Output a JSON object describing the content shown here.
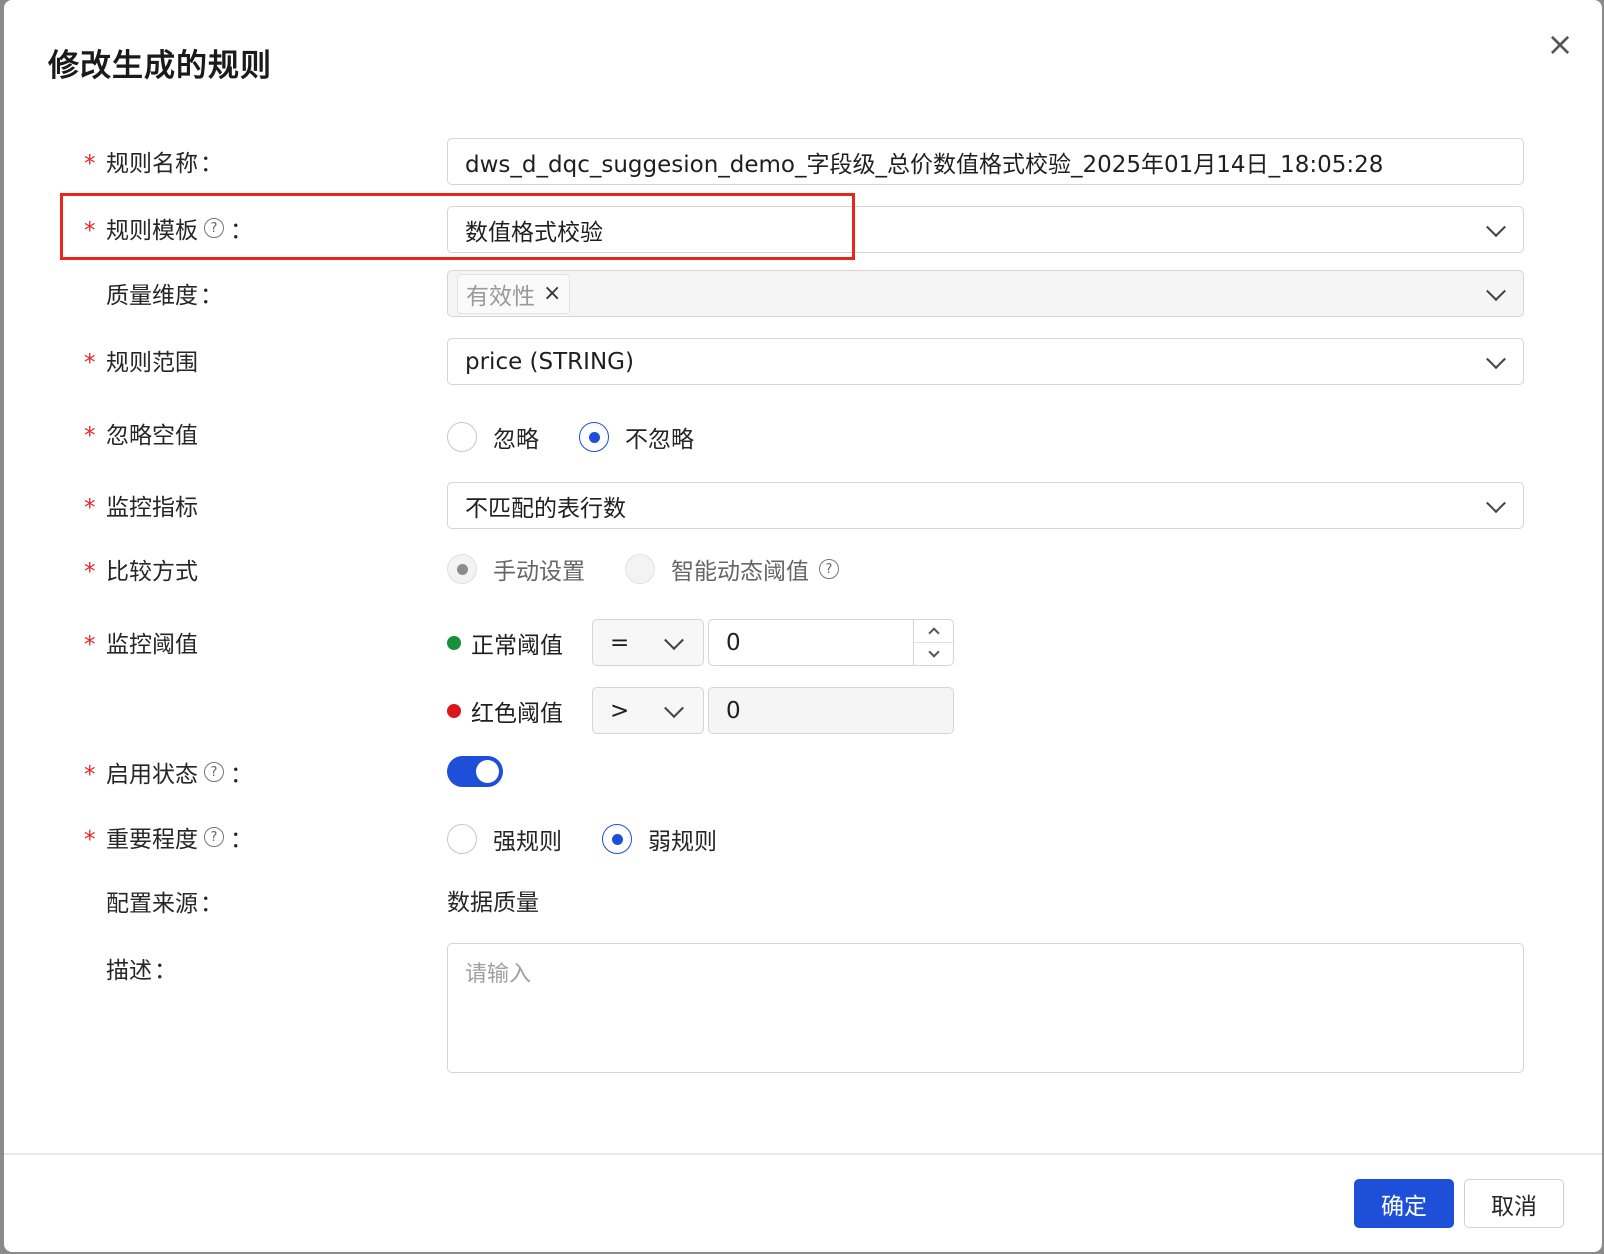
{
  "dialog": {
    "title": "修改生成的规则",
    "close_icon": "×",
    "ok_label": "确定",
    "cancel_label": "取消"
  },
  "form": {
    "rule_name": {
      "label": "规则名称",
      "colon": "：",
      "value": "dws_d_dqc_suggesion_demo_字段级_总价数值格式校验_2025年01月14日_18:05:28"
    },
    "rule_template": {
      "label": "规则模板",
      "colon": "：",
      "value": "数值格式校验"
    },
    "quality_dimension": {
      "label": "质量维度",
      "colon": "：",
      "tag": "有效性",
      "tag_remove": "×"
    },
    "rule_scope": {
      "label": "规则范围",
      "value": "price (STRING)"
    },
    "ignore_null": {
      "label": "忽略空值",
      "options": [
        "忽略",
        "不忽略"
      ],
      "selected": "不忽略"
    },
    "monitor_metric": {
      "label": "监控指标",
      "value": "不匹配的表行数"
    },
    "compare_mode": {
      "label": "比较方式",
      "options": [
        "手动设置",
        "智能动态阈值"
      ],
      "selected": "手动设置"
    },
    "threshold": {
      "label": "监控阈值",
      "normal": {
        "label": "正常阈值",
        "operator": "=",
        "value": "0",
        "color": "#1a8f3a"
      },
      "red": {
        "label": "红色阈值",
        "operator": ">",
        "value": "0",
        "color": "#d9181e"
      }
    },
    "enabled": {
      "label": "启用状态",
      "colon": "：",
      "on": true
    },
    "importance": {
      "label": "重要程度",
      "colon": "：",
      "options": [
        "强规则",
        "弱规则"
      ],
      "selected": "弱规则"
    },
    "config_source": {
      "label": "配置来源",
      "colon": "：",
      "value": "数据质量"
    },
    "description": {
      "label": "描述",
      "colon": "：",
      "placeholder": "请输入"
    }
  },
  "help_icon": "?",
  "required_mark": "*"
}
